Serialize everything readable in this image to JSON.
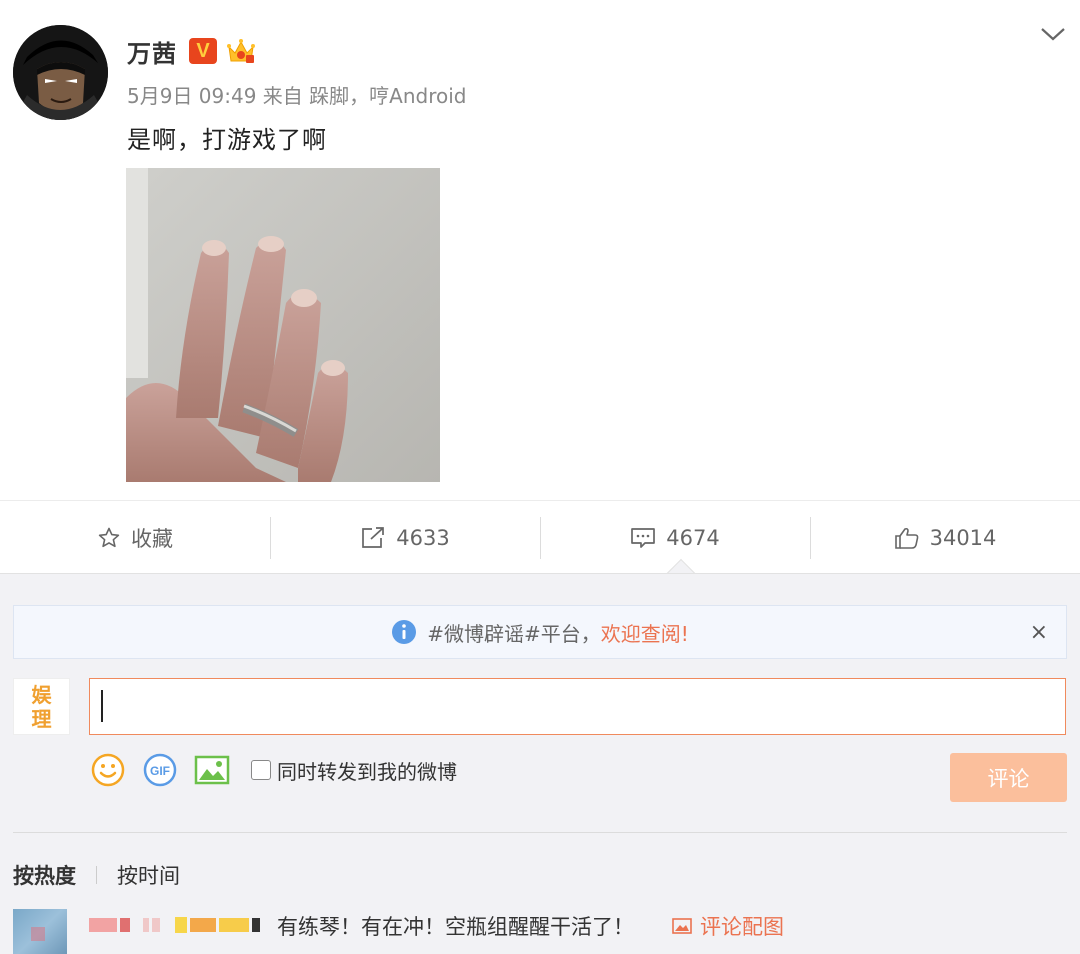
{
  "post": {
    "author": "万茜",
    "verified_badge": "V",
    "meta": "5月9日 09:49 来自 跺脚，哼Android",
    "text": "是啊，打游戏了啊",
    "image_alt": "hand-with-ring-photo"
  },
  "actions": {
    "favorite_label": "收藏",
    "repost_count": "4633",
    "comment_count": "4674",
    "like_count": "34014"
  },
  "notice": {
    "prefix": "#微博辟谣#平台，",
    "link": "欢迎查阅!",
    "close": "×"
  },
  "composer": {
    "avatar_text_top": "娱",
    "avatar_text_bottom": "理",
    "input_value": "",
    "repost_label": "同时转发到我的微博",
    "submit_label": "评论"
  },
  "sort": {
    "hot": "按热度",
    "time": "按时间"
  },
  "comments": [
    {
      "text": "有练琴！有在冲！空瓶组醒醒干活了！",
      "pic_link": "评论配图"
    }
  ],
  "colors": {
    "accent": "#eb7350",
    "verified": "#e8451d",
    "submit_disabled": "#fbbf9c",
    "notice_bg": "#f4f7fd"
  },
  "icons": [
    "chevron-down-icon",
    "star-icon",
    "repost-icon",
    "comment-icon",
    "like-icon",
    "info-icon",
    "emoji-icon",
    "gif-icon",
    "image-icon",
    "picture-icon"
  ]
}
